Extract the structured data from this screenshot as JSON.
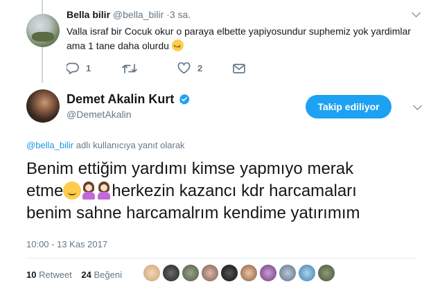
{
  "reply_tweet": {
    "name": "Bella bilir",
    "handle": "@bella_bilir",
    "separator": "·",
    "time": "3 sa.",
    "text": "Valla israf bir Cocuk okur o paraya elbette yapiyosundur suphemiz yok yardimlar ama 1 tane daha olurdu",
    "emoji": "slightly-frowning-face",
    "actions": {
      "reply_count": "1",
      "retweet_count": "",
      "like_count": "2",
      "dm_count": ""
    }
  },
  "main_tweet": {
    "name": "Demet Akalin Kurt",
    "handle": "@DemetAkalin",
    "verified": true,
    "follow_button": "Takip ediliyor",
    "replying_to_mention": "@bella_bilir",
    "replying_to_suffix": " adlı kullanıcıya yanıt olarak",
    "text_line1": "Benim ettiğim yardımı kimse yapmıyo merak",
    "text_line2_start": "etme",
    "text_line2_end": "herkezin kazancı kdr harcamaları",
    "text_line3": "benim sahne harcamalrım kendime yatırımım",
    "emojis": [
      "hugging-face",
      "woman-raising-hand",
      "woman-raising-hand"
    ],
    "timestamp": "10:00 - 13 Kas 2017",
    "retweet_count": "10",
    "retweet_label": "Retweet",
    "like_count": "24",
    "like_label": "Beğeni",
    "liker_avatars": 10
  },
  "colors": {
    "accent": "#1da1f2",
    "link": "#1b95e0",
    "muted": "#657786",
    "text": "#14171a"
  }
}
